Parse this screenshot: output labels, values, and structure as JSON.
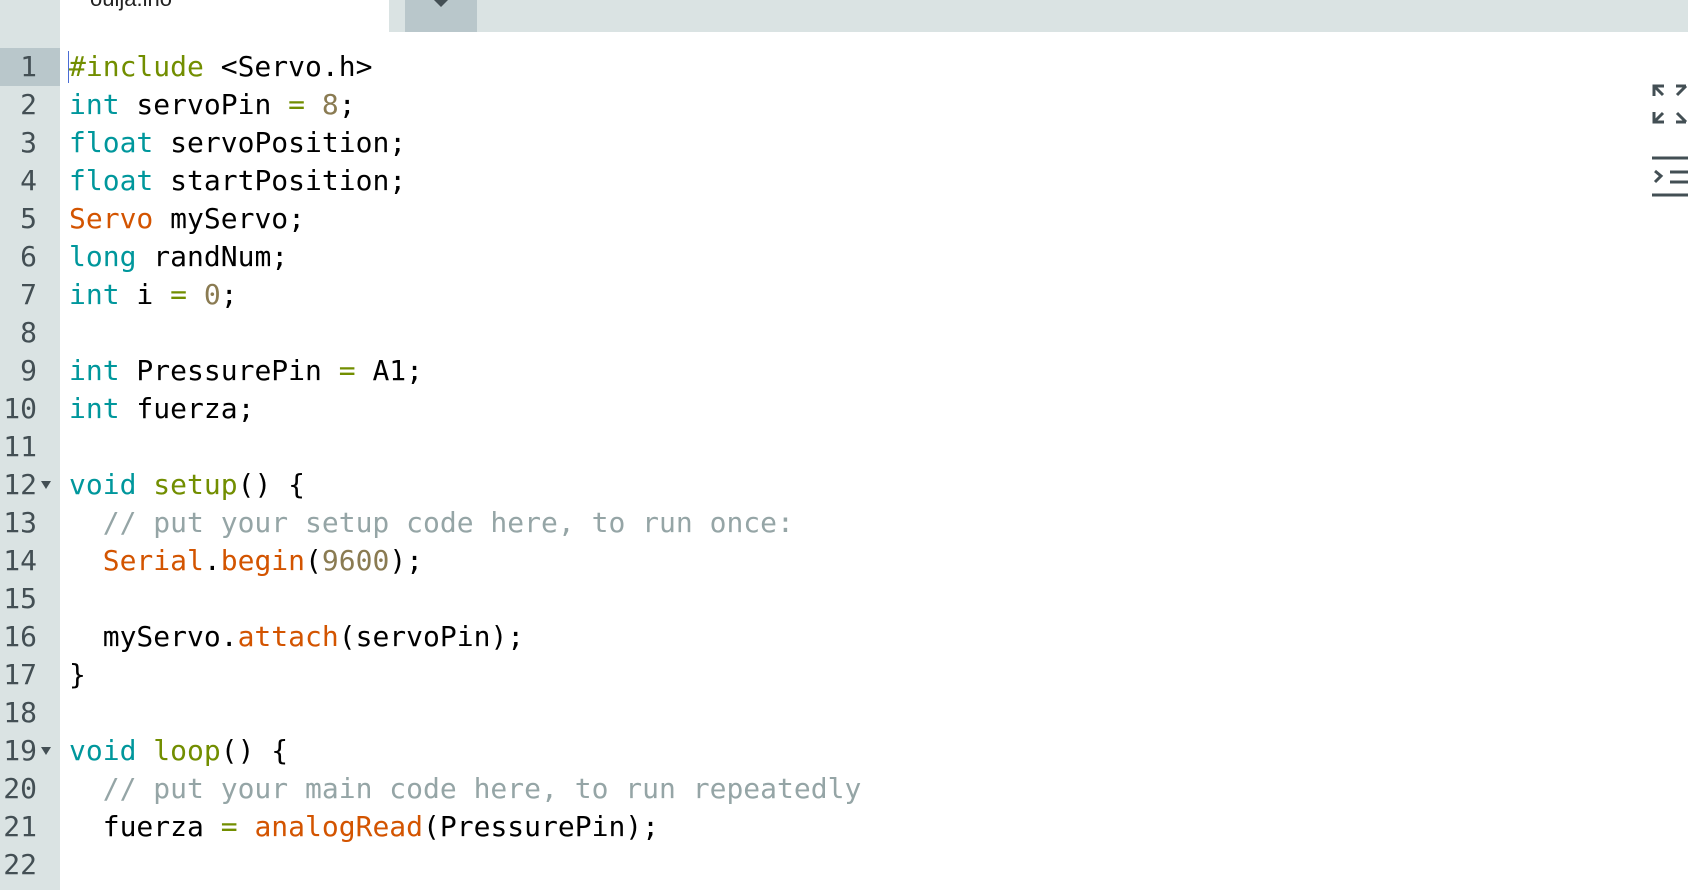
{
  "tabs": [
    {
      "label": "ouija.ino",
      "active": true
    }
  ],
  "tab_menu_icon": "caret-down-icon",
  "side_icons": [
    "expand-icon",
    "serial-monitor-icon"
  ],
  "colors": {
    "keyword": "#00979c",
    "preprocessor": "#728e00",
    "number": "#8a7b52",
    "class": "#d35400",
    "function": "#728e00",
    "comment": "#95a5a6",
    "gutter": "#dae3e3",
    "gutter_active": "#b9c7cb"
  },
  "code": {
    "active_line": 1,
    "lines": [
      {
        "n": "1",
        "t": [
          [
            "#include",
            "pp"
          ],
          [
            " <Servo.h>",
            "tx"
          ]
        ]
      },
      {
        "n": "2",
        "t": [
          [
            "int",
            "kw"
          ],
          [
            " servoPin ",
            "tx"
          ],
          [
            "=",
            "op"
          ],
          [
            " ",
            "tx"
          ],
          [
            "8",
            "num"
          ],
          [
            ";",
            "tx"
          ]
        ]
      },
      {
        "n": "3",
        "t": [
          [
            "float",
            "kw"
          ],
          [
            " servoPosition;",
            "tx"
          ]
        ]
      },
      {
        "n": "4",
        "t": [
          [
            "float",
            "kw"
          ],
          [
            " startPosition;",
            "tx"
          ]
        ]
      },
      {
        "n": "5",
        "t": [
          [
            "Servo",
            "cls"
          ],
          [
            " myServo;",
            "tx"
          ]
        ]
      },
      {
        "n": "6",
        "t": [
          [
            "long",
            "kw"
          ],
          [
            " randNum;",
            "tx"
          ]
        ]
      },
      {
        "n": "7",
        "t": [
          [
            "int",
            "kw"
          ],
          [
            " i ",
            "tx"
          ],
          [
            "=",
            "op"
          ],
          [
            " ",
            "tx"
          ],
          [
            "0",
            "num"
          ],
          [
            ";",
            "tx"
          ]
        ]
      },
      {
        "n": "8",
        "t": []
      },
      {
        "n": "9",
        "t": [
          [
            "int",
            "kw"
          ],
          [
            " PressurePin ",
            "tx"
          ],
          [
            "=",
            "op"
          ],
          [
            " A1;",
            "tx"
          ]
        ]
      },
      {
        "n": "10",
        "t": [
          [
            "int",
            "kw"
          ],
          [
            " fuerza;",
            "tx"
          ]
        ]
      },
      {
        "n": "11",
        "t": []
      },
      {
        "n": "12",
        "fold": true,
        "t": [
          [
            "void",
            "kw"
          ],
          [
            " ",
            "tx"
          ],
          [
            "setup",
            "fn"
          ],
          [
            "() {",
            "tx"
          ]
        ]
      },
      {
        "n": "13",
        "t": [
          [
            "  // put your setup code here, to run once:",
            "cm"
          ]
        ]
      },
      {
        "n": "14",
        "t": [
          [
            "  ",
            "tx"
          ],
          [
            "Serial",
            "cls"
          ],
          [
            ".",
            "tx"
          ],
          [
            "begin",
            "cls"
          ],
          [
            "(",
            "tx"
          ],
          [
            "9600",
            "num"
          ],
          [
            ");",
            "tx"
          ]
        ]
      },
      {
        "n": "15",
        "t": []
      },
      {
        "n": "16",
        "t": [
          [
            "  myServo.",
            "tx"
          ],
          [
            "attach",
            "cls"
          ],
          [
            "(servoPin);",
            "tx"
          ]
        ]
      },
      {
        "n": "17",
        "t": [
          [
            "}",
            "tx"
          ]
        ]
      },
      {
        "n": "18",
        "t": []
      },
      {
        "n": "19",
        "fold": true,
        "t": [
          [
            "void",
            "kw"
          ],
          [
            " ",
            "tx"
          ],
          [
            "loop",
            "fn"
          ],
          [
            "() {",
            "tx"
          ]
        ]
      },
      {
        "n": "20",
        "t": [
          [
            "  // put your main code here, to run repeatedly",
            "cm"
          ]
        ]
      },
      {
        "n": "21",
        "t": [
          [
            "  fuerza ",
            "tx"
          ],
          [
            "=",
            "op"
          ],
          [
            " ",
            "tx"
          ],
          [
            "analogRead",
            "cls"
          ],
          [
            "(PressurePin);",
            "tx"
          ]
        ]
      },
      {
        "n": "22",
        "t": []
      }
    ]
  }
}
